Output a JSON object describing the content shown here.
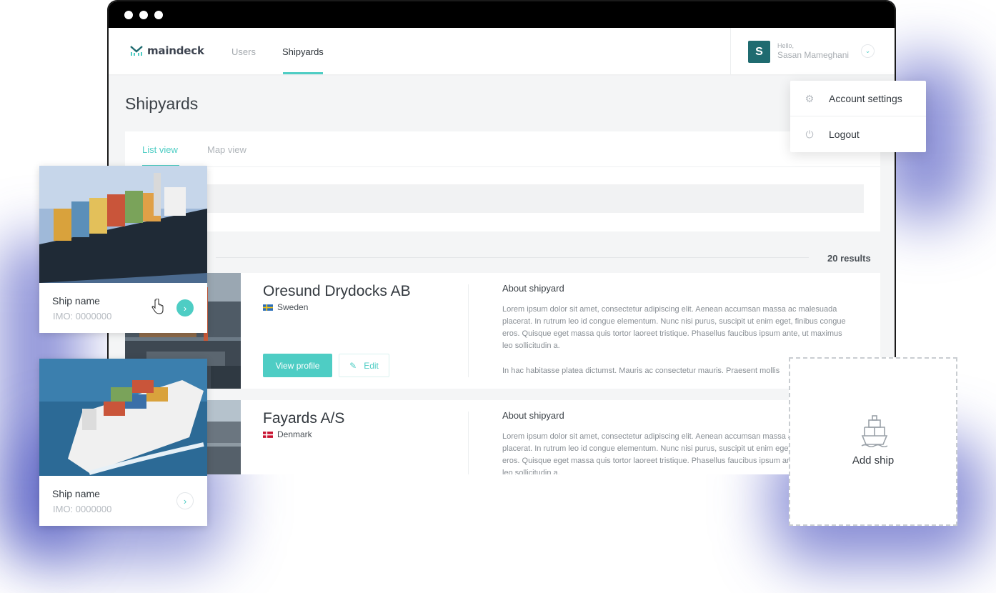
{
  "window": {
    "controls": [
      "close",
      "minimize",
      "maximize"
    ]
  },
  "brand": {
    "name": "maindeck",
    "accent": "#4ecdc4"
  },
  "nav": {
    "items": [
      {
        "label": "Users"
      },
      {
        "label": "Shipyards"
      }
    ],
    "active": "Shipyards"
  },
  "user": {
    "initial": "S",
    "greeting": "Hello,",
    "name": "Sasan Mameghani",
    "avatar_color": "#1f6b70"
  },
  "page": {
    "title": "Shipyards"
  },
  "view_tabs": [
    {
      "label": "List view"
    },
    {
      "label": "Map view"
    }
  ],
  "results": {
    "count_text": "20 results"
  },
  "shipyards": [
    {
      "name": "Oresund Drydocks AB",
      "country": "Sweden",
      "flag": "sweden-flag",
      "about_title": "About shipyard",
      "about_text": "Lorem ipsum dolor sit amet, consectetur adipiscing elit. Aenean accumsan massa ac malesuada placerat. In rutrum leo id congue elementum. Nunc nisi purus, suscipit ut enim eget, finibus congue eros. Quisque eget massa quis tortor laoreet tristique. Phasellus faucibus ipsum ante, ut maximus leo sollicitudin a.",
      "about_text_2": "In hac habitasse platea dictumst. Mauris ac consectetur mauris. Praesent mollis",
      "view_label": "View profile",
      "edit_label": "Edit"
    },
    {
      "name": "Fayards A/S",
      "country": "Denmark",
      "flag": "denmark-flag",
      "about_title": "About shipyard",
      "about_text": "Lorem ipsum dolor sit amet, consectetur adipiscing elit. Aenean accumsan massa ac malesuada placerat. In rutrum leo id congue elementum. Nunc nisi purus, suscipit ut enim eget, finibus congue eros. Quisque eget massa quis tortor laoreet tristique. Phasellus faucibus ipsum ante, ut maximus leo sollicitudin a."
    }
  ],
  "user_menu": [
    {
      "label": "Account settings",
      "icon": "gear-icon"
    },
    {
      "label": "Logout",
      "icon": "power-icon"
    }
  ],
  "ships": [
    {
      "name": "Ship name",
      "imo": "IMO: 0000000",
      "hover": true
    },
    {
      "name": "Ship name",
      "imo": "IMO: 0000000",
      "hover": false
    }
  ],
  "add_ship": {
    "label": "Add ship",
    "icon": "ship-icon"
  }
}
